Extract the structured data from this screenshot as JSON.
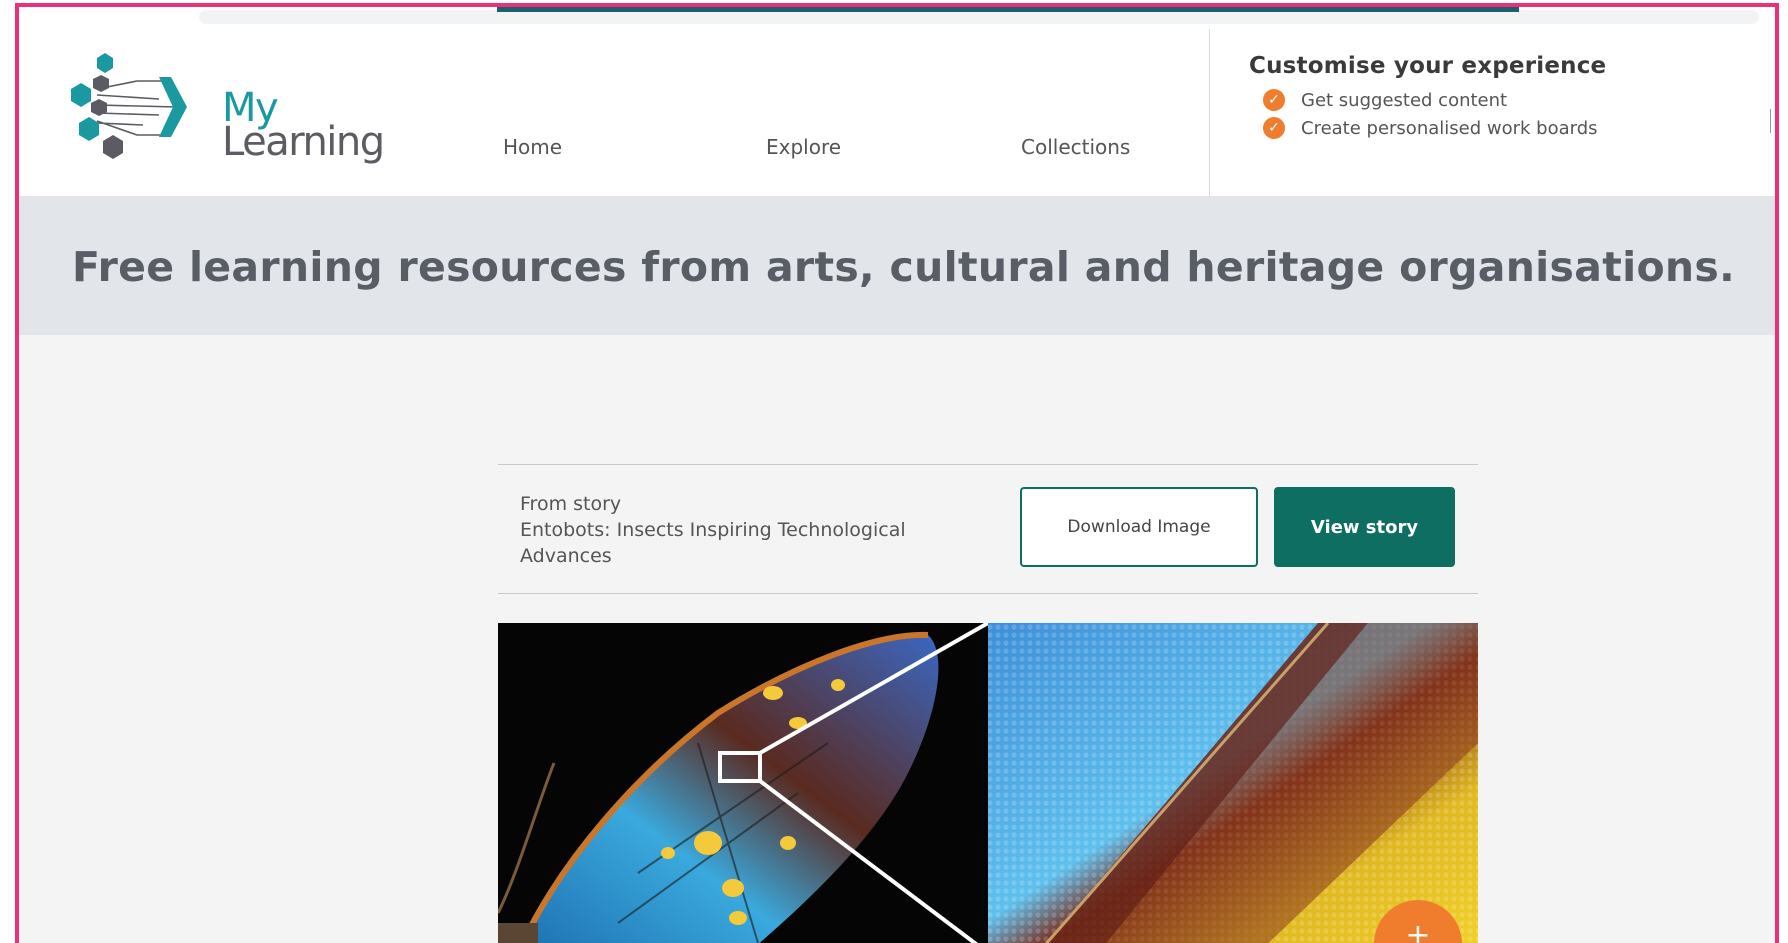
{
  "header": {
    "logo": {
      "line1": "My",
      "line2": "Learning"
    },
    "nav": {
      "home": "Home",
      "explore": "Explore",
      "collections": "Collections"
    }
  },
  "customise": {
    "title": "Customise your experience",
    "items": [
      "Get suggested content",
      "Create personalised work boards"
    ]
  },
  "banner": {
    "text": "Free learning resources from arts, cultural and heritage organisations."
  },
  "story": {
    "label": "From story",
    "title": "Entobots: Insects Inspiring Technological Advances",
    "download_label": "Download Image",
    "view_label": "View story"
  },
  "fab": {
    "label": "+"
  },
  "colors": {
    "brand_teal": "#1a9aa0",
    "button_teal": "#0e6e62",
    "accent_orange": "#ef7d2d",
    "frame_pink": "#e8317a",
    "banner_bg": "#e2e5ea"
  }
}
